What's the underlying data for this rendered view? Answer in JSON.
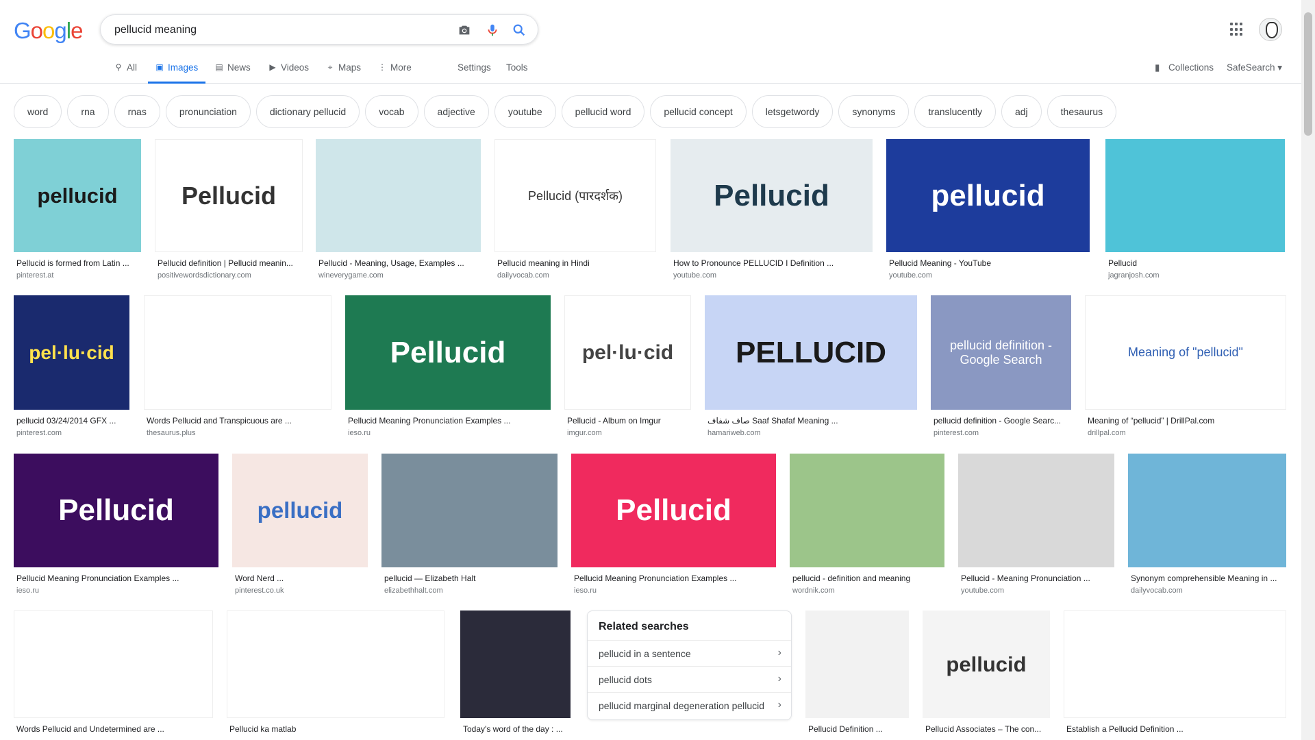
{
  "header": {
    "logo_letters": [
      {
        "ch": "G",
        "color": "#4285f4"
      },
      {
        "ch": "o",
        "color": "#ea4335"
      },
      {
        "ch": "o",
        "color": "#fbbc05"
      },
      {
        "ch": "g",
        "color": "#4285f4"
      },
      {
        "ch": "l",
        "color": "#34a853"
      },
      {
        "ch": "e",
        "color": "#ea4335"
      }
    ],
    "query": "pellucid meaning"
  },
  "tabs": [
    {
      "label": "All",
      "icon": "search-icon",
      "active": false
    },
    {
      "label": "Images",
      "icon": "image-icon",
      "active": true
    },
    {
      "label": "News",
      "icon": "news-icon",
      "active": false
    },
    {
      "label": "Videos",
      "icon": "video-icon",
      "active": false
    },
    {
      "label": "Maps",
      "icon": "map-icon",
      "active": false
    },
    {
      "label": "More",
      "icon": "more-vertical-icon",
      "active": false
    }
  ],
  "tools": {
    "settings": "Settings",
    "tools": "Tools",
    "collections": "Collections",
    "safesearch": "SafeSearch"
  },
  "chips": [
    "word",
    "rna",
    "rnas",
    "pronunciation",
    "dictionary pellucid",
    "vocab",
    "adjective",
    "youtube",
    "pellucid word",
    "pellucid concept",
    "letsgetwordy",
    "synonyms",
    "translucently",
    "adj",
    "thesaurus"
  ],
  "results": [
    {
      "title": "Pellucid is formed from Latin ...",
      "source": "pinterest.at",
      "text": "pellucid",
      "bg": "#7fd0d6",
      "fg": "#1a1a1a"
    },
    {
      "title": "Pellucid definition | Pellucid meanin...",
      "source": "positivewordsdictionary.com",
      "text": "Pellucid",
      "bg": "#ffffff",
      "fg": "#333333"
    },
    {
      "title": "Pellucid - Meaning, Usage, Examples ...",
      "source": "wineverygame.com",
      "text": "",
      "bg": "#cfe6ea",
      "fg": "#333333"
    },
    {
      "title": "Pellucid meaning in Hindi",
      "source": "dailyvocab.com",
      "text": "Pellucid (पारदर्शक)",
      "bg": "#ffffff",
      "fg": "#333333"
    },
    {
      "title": "How to Pronounce PELLUCID I Definition ...",
      "source": "youtube.com",
      "text": "Pellucid",
      "bg": "#e6ecef",
      "fg": "#1e3a4c"
    },
    {
      "title": "Pellucid Meaning - YouTube",
      "source": "youtube.com",
      "text": "pellucid",
      "bg": "#1d3c9c",
      "fg": "#ffffff"
    },
    {
      "title": "Pellucid",
      "source": "jagranjosh.com",
      "text": "",
      "bg": "#4fc3d8",
      "fg": "#ffffff"
    },
    {
      "title": "pellucid 03/24/2014 GFX ...",
      "source": "pinterest.com",
      "text": "pel·lu·cid",
      "bg": "#1a2a6e",
      "fg": "#ffe14d"
    },
    {
      "title": "Words Pellucid and Transpicuous are ...",
      "source": "thesaurus.plus",
      "text": "",
      "bg": "#ffffff",
      "fg": "#333333"
    },
    {
      "title": "Pellucid Meaning Pronunciation Examples ...",
      "source": "ieso.ru",
      "text": "Pellucid",
      "bg": "#1e7a52",
      "fg": "#ffffff"
    },
    {
      "title": "Pellucid - Album on Imgur",
      "source": "imgur.com",
      "text": "pel·lu·cid",
      "bg": "#ffffff",
      "fg": "#444444"
    },
    {
      "title": "صاف شفاف Saaf Shafaf Meaning ...",
      "source": "hamariweb.com",
      "text": "PELLUCID",
      "bg": "#c7d5f5",
      "fg": "#1a1a1a"
    },
    {
      "title": "pellucid definition - Google Searc...",
      "source": "pinterest.com",
      "text": "pellucid definition - Google Search",
      "bg": "#8a98c2",
      "fg": "#ffffff"
    },
    {
      "title": "Meaning of “pellucid” | DrillPal.com",
      "source": "drillpal.com",
      "text": "Meaning of \"pellucid\"",
      "bg": "#ffffff",
      "fg": "#2f5fb3"
    },
    {
      "title": "Pellucid Meaning Pronunciation Examples ...",
      "source": "ieso.ru",
      "text": "Pellucid",
      "bg": "#3c0d5e",
      "fg": "#ffffff"
    },
    {
      "title": "Word Nerd ...",
      "source": "pinterest.co.uk",
      "text": "pellucid",
      "bg": "#f6e7e3",
      "fg": "#3a6fc4"
    },
    {
      "title": "pellucid — Elizabeth Halt",
      "source": "elizabethhalt.com",
      "text": "",
      "bg": "#7a8e9c",
      "fg": "#ffffff"
    },
    {
      "title": "Pellucid Meaning Pronunciation Examples ...",
      "source": "ieso.ru",
      "text": "Pellucid",
      "bg": "#f02a5e",
      "fg": "#ffffff"
    },
    {
      "title": "pellucid - definition and meaning",
      "source": "wordnik.com",
      "text": "",
      "bg": "#9cc58a",
      "fg": "#333333"
    },
    {
      "title": "Pellucid - Meaning Pronunciation ...",
      "source": "youtube.com",
      "text": "",
      "bg": "#d9d9d9",
      "fg": "#333333"
    },
    {
      "title": "Synonym comprehensible Meaning in ...",
      "source": "dailyvocab.com",
      "text": "",
      "bg": "#6fb5d8",
      "fg": "#ffffff"
    },
    {
      "title": "Words Pellucid and Undetermined are ...",
      "source": "",
      "text": "",
      "bg": "#ffffff",
      "fg": "#333333"
    },
    {
      "title": "Pellucid ka matlab",
      "source": "",
      "text": "",
      "bg": "#ffffff",
      "fg": "#333333"
    },
    {
      "title": "Today's word of the day : ...",
      "source": "",
      "text": "",
      "bg": "#2b2b3a",
      "fg": "#ffffff"
    },
    {
      "title": "Pellucid Definition ...",
      "source": "",
      "text": "",
      "bg": "#f2f2f2",
      "fg": "#333333"
    },
    {
      "title": "Pellucid Associates – The con...",
      "source": "",
      "text": "pellucid",
      "bg": "#f4f4f4",
      "fg": "#333333"
    },
    {
      "title": "Establish a Pellucid Definition ...",
      "source": "",
      "text": "",
      "bg": "#ffffff",
      "fg": "#333333"
    }
  ],
  "related": {
    "title": "Related searches",
    "items": [
      "pellucid in a sentence",
      "pellucid dots",
      "pellucid marginal degeneration pellucid"
    ]
  }
}
